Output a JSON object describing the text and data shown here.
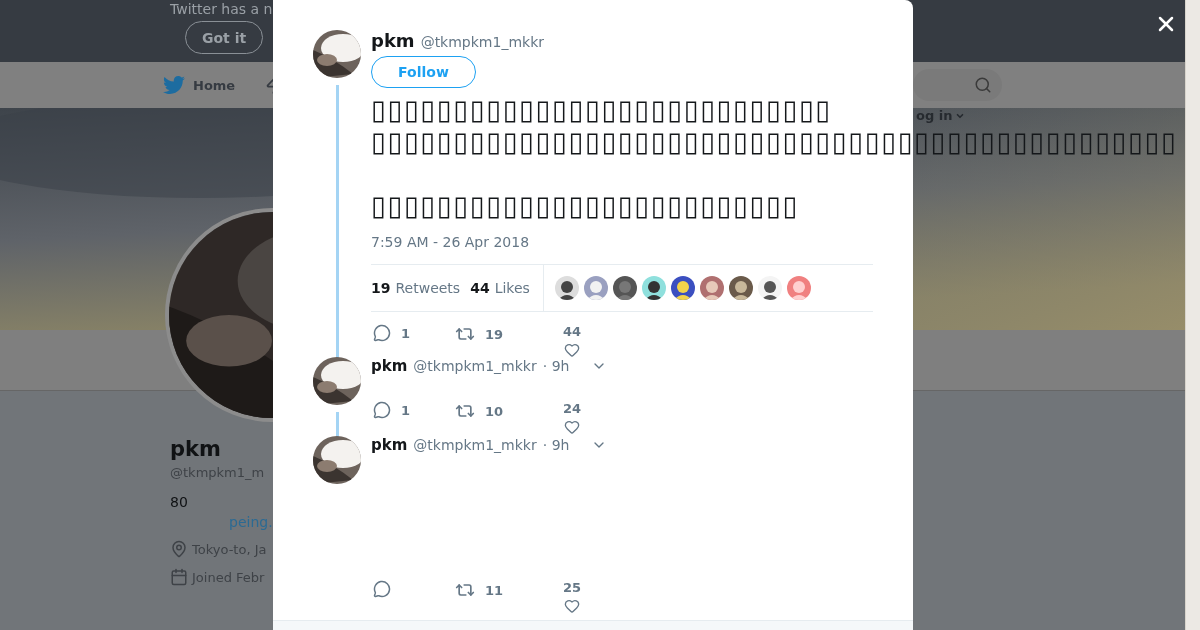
{
  "notice_bar": {
    "text": "Twitter has a n",
    "button": "Got it"
  },
  "nav": {
    "home": "Home",
    "login": "og in"
  },
  "profile": {
    "name": "pkm",
    "handle": "@tkmpkm1_m",
    "bio": "80",
    "link": "peing.",
    "location": "Tokyo-to, Ja",
    "joined": "Joined Febr"
  },
  "tweet": {
    "name": "pkm",
    "handle": "@tkmpkm1_mkkr",
    "follow_button": "Follow",
    "paragraphs": [
      [
        "▯▯▯▯▯▯▯▯▯▯▯▯▯▯▯▯▯▯▯▯▯▯▯▯▯▯▯▯",
        "▯▯▯▯▯▯▯▯▯▯▯▯▯▯▯▯▯▯▯▯▯▯▯▯▯▯▯▯▯▯▯▯▯▯▯▯▯▯▯▯▯▯▯▯▯▯▯▯▯"
      ],
      [
        "▯▯▯▯▯▯▯▯▯▯▯▯▯▯▯▯▯▯▯▯▯▯▯▯▯▯"
      ]
    ],
    "timestamp": "7:59 AM - 26 Apr 2018",
    "stats": [
      {
        "count": "19",
        "label": "Retweets"
      },
      {
        "count": "44",
        "label": "Likes"
      }
    ],
    "likers": [
      {
        "kind": "picture"
      },
      {
        "kind": "picture"
      },
      {
        "kind": "picture"
      },
      {
        "kind": "picture"
      },
      {
        "kind": "picture"
      },
      {
        "kind": "picture"
      },
      {
        "kind": "picture"
      },
      {
        "kind": "picture"
      },
      {
        "kind": "picture"
      }
    ],
    "actions": {
      "replies": "1",
      "retweets": "19",
      "likes": "44"
    }
  },
  "replies": [
    {
      "name": "pkm",
      "handle": "@tkmpkm1_mkkr",
      "time": "· 9h",
      "tall": false,
      "actions": {
        "replies": "1",
        "retweets": "10",
        "likes": "24"
      }
    },
    {
      "name": "pkm",
      "handle": "@tkmpkm1_mkkr",
      "time": "· 9h",
      "tall": true,
      "actions": {
        "retweets": "11",
        "likes": "25"
      }
    }
  ]
}
